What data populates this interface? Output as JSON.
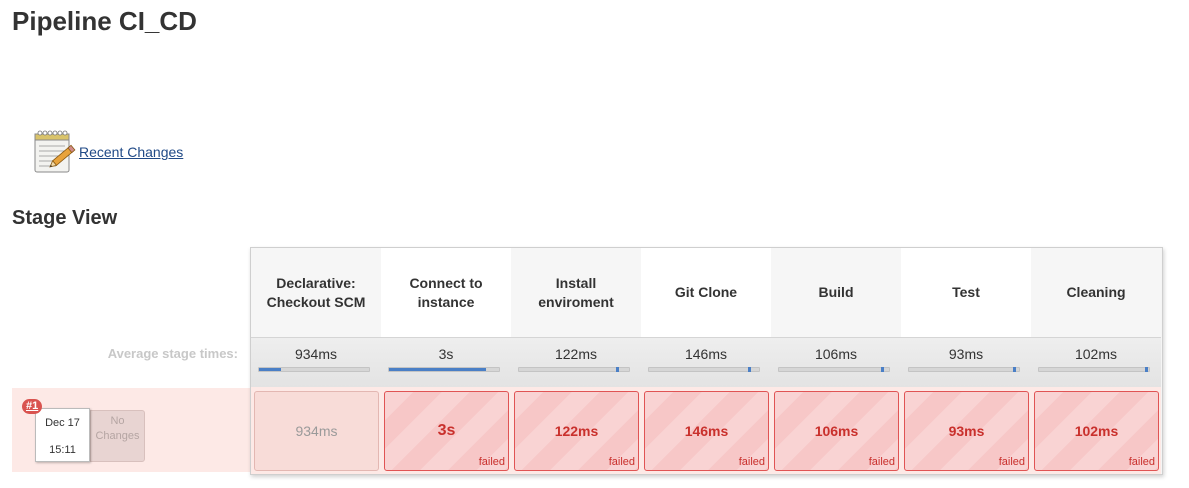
{
  "page": {
    "title": "Pipeline CI_CD"
  },
  "recent_changes": {
    "icon": "notepad-icon",
    "label": "Recent Changes"
  },
  "stage_view": {
    "title": "Stage View",
    "average_label": "Average stage times:",
    "run": {
      "badge": "#1",
      "date": "Dec 17",
      "time": "15:11",
      "changes_line1": "No",
      "changes_line2": "Changes"
    },
    "failed_label": "failed",
    "colors": {
      "failed_border": "#e05454",
      "failed_text": "#c9302c",
      "progress": "#4a7fc6"
    },
    "stages": [
      {
        "name": "Declarative: Checkout SCM",
        "avg": "934ms",
        "result": "934ms",
        "status": "success",
        "progress": 0.2
      },
      {
        "name": "Connect to instance",
        "avg": "3s",
        "result": "3s",
        "status": "failed",
        "progress": 0.88
      },
      {
        "name": "Install enviroment",
        "avg": "122ms",
        "result": "122ms",
        "status": "failed",
        "progress": 0.91
      },
      {
        "name": "Git Clone",
        "avg": "146ms",
        "result": "146ms",
        "status": "failed",
        "progress": 0.93
      },
      {
        "name": "Build",
        "avg": "106ms",
        "result": "106ms",
        "status": "failed",
        "progress": 0.95
      },
      {
        "name": "Test",
        "avg": "93ms",
        "result": "93ms",
        "status": "failed",
        "progress": 0.97
      },
      {
        "name": "Cleaning",
        "avg": "102ms",
        "result": "102ms",
        "status": "failed",
        "progress": 0.99
      }
    ]
  }
}
